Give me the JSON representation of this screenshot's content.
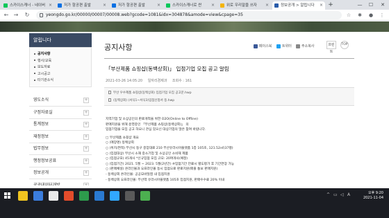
{
  "browser": {
    "tabs": [
      {
        "label": "스카이스캐너 - 네이버",
        "fav": "#03c75a",
        "active": false
      },
      {
        "label": "저가 항공편 출발",
        "fav": "#0770e3",
        "active": false
      },
      {
        "label": "저가 항공편 출발",
        "fav": "#0770e3",
        "active": false
      },
      {
        "label": "스카이스캐너로 싼",
        "fav": "#03c75a",
        "active": false
      },
      {
        "label": "위로 우리말을 쓰자",
        "fav": "#f4b400",
        "active": false
      },
      {
        "label": "정보공개 > 알립니다",
        "fav": "#2a5caa",
        "active": true
      }
    ],
    "new_tab": "+",
    "url": "yeongdo.go.kr/00000/00007/00008.web?gcode=1081&idx=304878&amode=view&cpage=35",
    "controls": {
      "minimize": "—",
      "maximize": "☐",
      "close": "✕"
    }
  },
  "sidebar": {
    "title": "알립니다",
    "subitems": [
      {
        "label": "공지사항",
        "active": true
      },
      {
        "label": "행사/교육",
        "active": false
      },
      {
        "label": "보도자료",
        "active": false
      },
      {
        "label": "고시공고",
        "active": false
      },
      {
        "label": "타기관소식",
        "active": false
      }
    ],
    "menus": [
      "영도소식",
      "구정자료실",
      "통계정보",
      "재정정보",
      "법무정보",
      "행정정보공표",
      "정보공개",
      "공공데이터개방"
    ]
  },
  "content": {
    "page_title": "공지사항",
    "share": [
      "페이스북",
      "트위터",
      "주소복사"
    ],
    "print_label": "프린트",
    "top_label": "TOP",
    "post_title": "「부산제품 쇼핑샵(동백상회)」 입점기업 모집 공고 알림",
    "meta": [
      "2021-03-26 14:05:20",
      "일자리경제과",
      "조회수 : 161"
    ],
    "files": [
      "부산 우수제품 쇼핑샵(동백상회) 입점기업 모집 공고문.hwp",
      "(동백상회) (서식1~서식3)입점신청서 등.hwp"
    ],
    "body": [
      "지역기업 및 소상공인의 판로개척을 위한 O2O(Online to Offline)",
      "판매지원을 위해 운영중인 「부산제품 쇼핑샵(동백상회)」 의",
      "입점기업을 모집 공고 하오니 관심 있으신 대상기업의 많은 참여 바랍니다.",
      "",
      "□ 부산제품 쇼핑샵 개요",
      "○ (매장명) 동백상회",
      "○ (위치/면적) 부산시 동구 중앙대로 210 부산유라시아플랫폼 1층 105호, 121.52㎡(37평)",
      "○ (입점대상) 부산시 소재 중소기업 및 소상공인 소비재 제품",
      "○ (입점규모) 45개사 *신규입점 모집 규모: 20여개사(예정)",
      "○ (입점기간) 2021. 5월 ~ 2023. 5월(2년간) ※입점기간 만료시 별도평가 후 기간연장 가능",
      "○ (판매채널) 온라인몰과 오프라인몰 동시 입점으로 판로지원(매출 통보 판매지원)",
      " - 동백상회 온라인몰: 공공모바일앱 내 입점지원",
      " - 동백상회 오프라인몰: 부산역 유라시아플랫폼 105호 입점지원, 판매수수료 20% 이내"
    ]
  },
  "taskbar": {
    "time": "오후 9:20",
    "date": "2021-11-04",
    "apps": [
      "#f0c420",
      "#3b7ddd",
      "#e8e8e8",
      "#e44c2b",
      "#2d9b4c",
      "#2a7ad2",
      "#31a8ff",
      "#5a5a5a",
      "#4caf50"
    ]
  }
}
